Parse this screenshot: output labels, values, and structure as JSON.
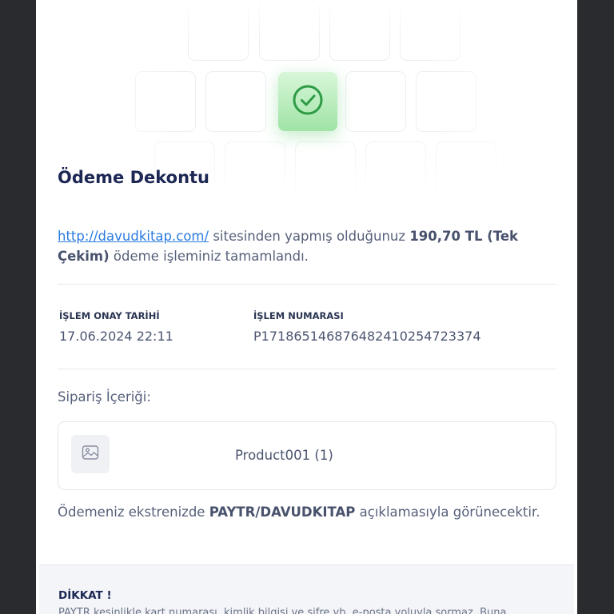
{
  "receipt": {
    "title": "Ödeme Dekontu",
    "summary": {
      "site_link": "http://davudkitap.com/",
      "text_before_amount": " sitesinden yapmış olduğunuz ",
      "amount": "190,70 TL (Tek Çekim)",
      "text_after_amount": " ödeme işleminiz tamamlandı."
    },
    "approval_date": {
      "label": "İŞLEM ONAY TARİHİ",
      "value": "17.06.2024 22:11"
    },
    "transaction_number": {
      "label": "İŞLEM NUMARASI",
      "value": "P17186514687648241025472337​4"
    },
    "order_contents_label": "Sipariş İçeriği:",
    "products": [
      {
        "name": "Product001 (1)",
        "icon": "image-placeholder-icon"
      }
    ],
    "statement": {
      "before": "Ödemeniz ekstrenizde ",
      "merchant": "PAYTR/DAVUDKITAP",
      "after": " açıklamasıyla görünecektir."
    },
    "warning": {
      "title": "DİKKAT !",
      "text": "PAYTR kesinlikle kart numarası, kimlik bilgisi ve şifre vb. e-posta yoluyla sormaz. Buna"
    }
  },
  "colors": {
    "title": "#1c2754",
    "link": "#2b7be0",
    "success": "#2e9a46",
    "page_bg": "#2a2b2e"
  }
}
